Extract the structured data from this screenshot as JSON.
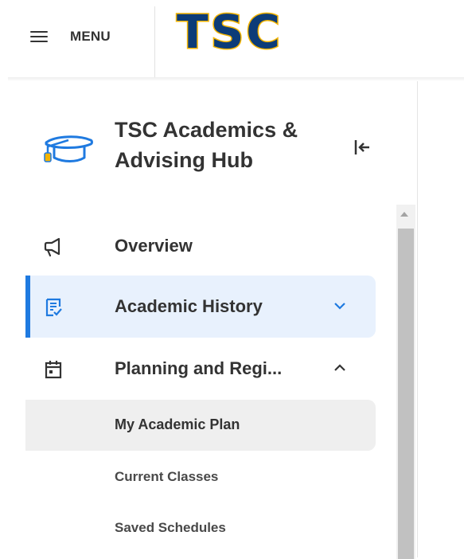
{
  "header": {
    "menu_label": "MENU",
    "logo_text": "TSC",
    "logo_colors": {
      "fill": "#0c3c78",
      "outline": "#f4b400"
    }
  },
  "sidebar": {
    "hub_icon": "graduation-cap-icon",
    "title": "TSC Academics & Advising Hub",
    "collapse_icon": "collapse-left-icon",
    "accent_color": "#1f7ae0",
    "items": [
      {
        "label": "Overview",
        "icon": "megaphone-icon",
        "expanded": null,
        "selected": false
      },
      {
        "label": "Academic History",
        "icon": "transcript-icon",
        "chevron": "chevron-down-icon",
        "selected": true
      },
      {
        "label": "Planning and Regi...",
        "icon": "calendar-icon",
        "chevron": "chevron-up-icon",
        "selected": false
      }
    ],
    "subitems": [
      {
        "label": "My Academic Plan",
        "active": true
      },
      {
        "label": "Current Classes",
        "active": false
      },
      {
        "label": "Saved Schedules",
        "active": false
      }
    ]
  }
}
